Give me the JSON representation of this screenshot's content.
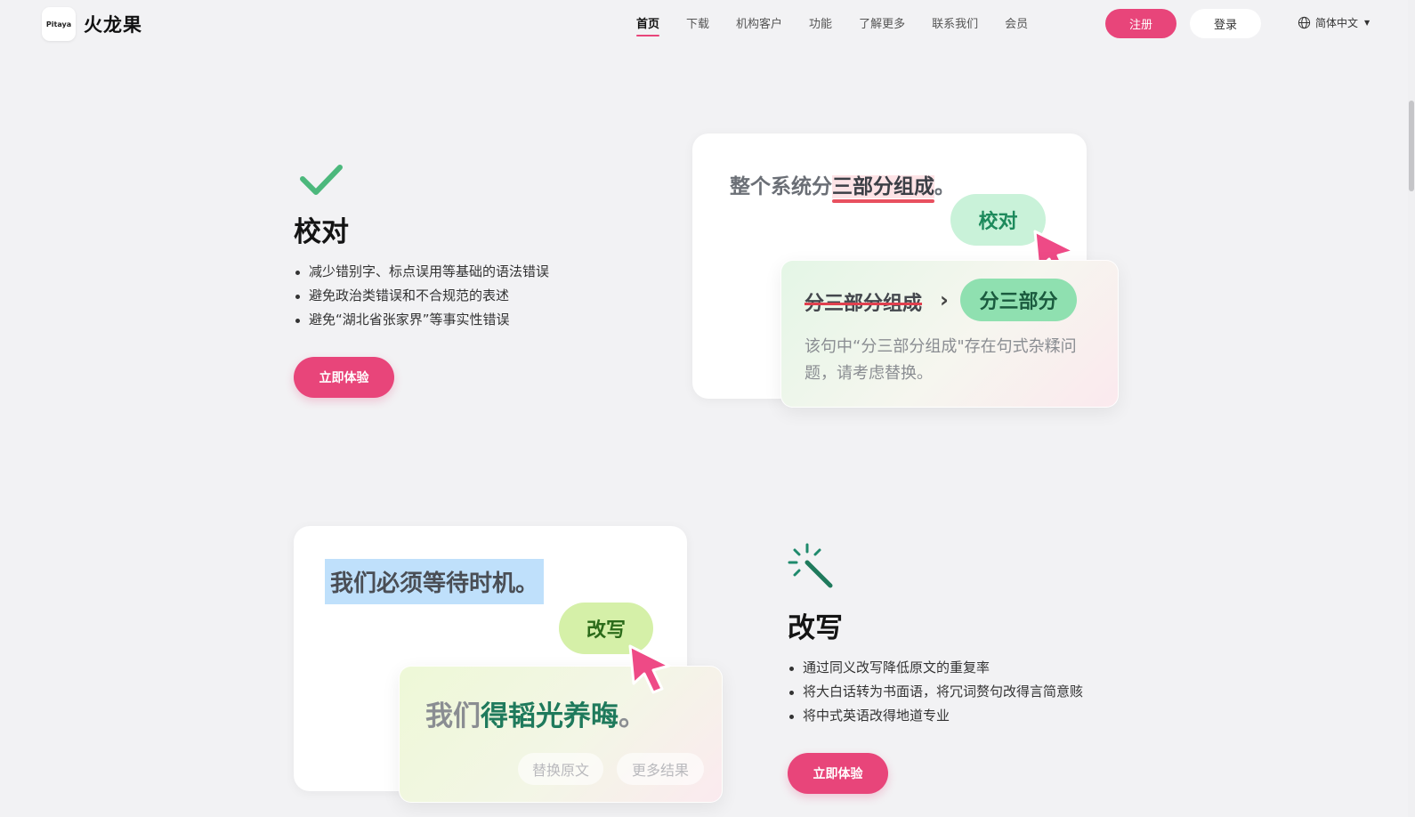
{
  "header": {
    "logo_text": "Pitaya",
    "brand": "火龙果",
    "nav": [
      "首页",
      "下载",
      "机构客户",
      "功能",
      "了解更多",
      "联系我们",
      "会员"
    ],
    "register_label": "注册",
    "login_label": "登录",
    "language_label": "简体中文"
  },
  "proofread": {
    "title": "校对",
    "bullets": [
      "减少错别字、标点误用等基础的语法错误",
      "避免政治类错误和不合规范的表述",
      "避免“湖北省张家界”等事实性错误"
    ],
    "cta": "立即体验",
    "demo": {
      "sentence_prefix": "整个系统分",
      "sentence_highlight": "三部分组成",
      "sentence_suffix": "。",
      "action_pill": "校对",
      "original": "分三部分组成",
      "arrow": "›",
      "suggestion": "分三部分",
      "explanation": "该句中“分三部分组成\"存在句式杂糅问题，请考虑替换。"
    }
  },
  "rewrite": {
    "title": "改写",
    "bullets": [
      "通过同义改写降低原文的重复率",
      "将大白话转为书面语，将冗词赘句改得言简意赅",
      "将中式英语改得地道专业"
    ],
    "cta": "立即体验",
    "demo": {
      "sentence": "我们必须等待时机。",
      "action_pill": "改写",
      "result_prefix": "我们",
      "result_highlight": "得韬光养晦",
      "result_suffix": "。",
      "btn_replace": "替换原文",
      "btn_more": "更多结果"
    }
  },
  "colors": {
    "accent": "#e8457a",
    "background": "#f2f2f4",
    "check_green": "#4cb87c",
    "teal": "#1f8a6c"
  }
}
